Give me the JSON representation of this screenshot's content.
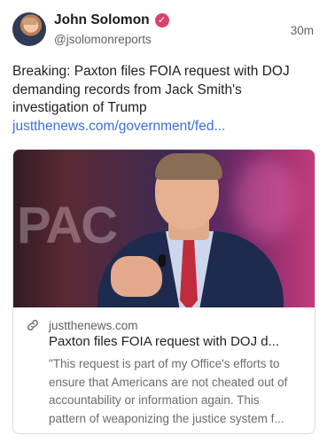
{
  "author": {
    "name": "John Solomon",
    "handle": "@jsolomonreports",
    "verified_glyph": "✓",
    "verified_color": "#d9426a"
  },
  "post": {
    "time": "30m",
    "text": "Breaking: Paxton files FOIA request with DOJ demanding records from Jack Smith's investigation of Trump ",
    "link_text": "justthenews.com/government/fed...",
    "link_color": "#3a6fd8"
  },
  "card": {
    "image_icon": "photo",
    "domain_icon": "link-icon",
    "domain": "justthenews.com",
    "title": "Paxton files FOIA request with DOJ d...",
    "description_lines": [
      "\"This request is part of my Office's efforts to",
      "ensure that Americans are not cheated out of",
      "accountability or information again. This",
      "pattern of weaponizing the justice system f..."
    ]
  }
}
